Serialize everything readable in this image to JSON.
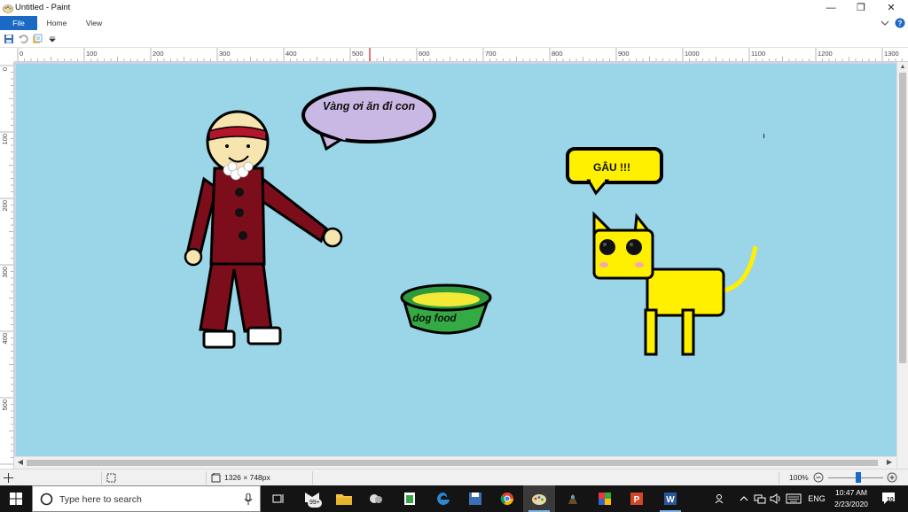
{
  "window": {
    "title": "Untitled - Paint",
    "controls": [
      "minimize",
      "restore",
      "close"
    ]
  },
  "ribbon": {
    "tabs": [
      {
        "label": "File"
      },
      {
        "label": "Home"
      },
      {
        "label": "View"
      }
    ]
  },
  "rulers": {
    "horizontal": [
      "0",
      "100",
      "200",
      "300",
      "400",
      "500",
      "600",
      "700",
      "800",
      "900",
      "1000",
      "1100",
      "1200",
      "1300"
    ],
    "vertical": [
      "0",
      "100",
      "200",
      "300",
      "400",
      "500"
    ]
  },
  "drawing": {
    "speech_man": "Vàng ơi ăn đi con",
    "speech_dog": "GÂU !!!",
    "bowl_label": "dog food",
    "colors": {
      "canvas": "#9ad6e8",
      "robe": "#7b0e1a",
      "face": "#f7e5b0",
      "dog": "#fff000",
      "bowl": "#33aa44",
      "bubble_man": "#c9b8e4",
      "bubble_dog": "#fff000"
    }
  },
  "statusbar": {
    "dimensions": "1326 × 748px",
    "zoom": "100%"
  },
  "taskbar": {
    "search_placeholder": "Type here to search",
    "mail_badge": "99+",
    "language": "ENG",
    "time": "10:47 AM",
    "date": "2/23/2020",
    "notification_count": "10"
  }
}
